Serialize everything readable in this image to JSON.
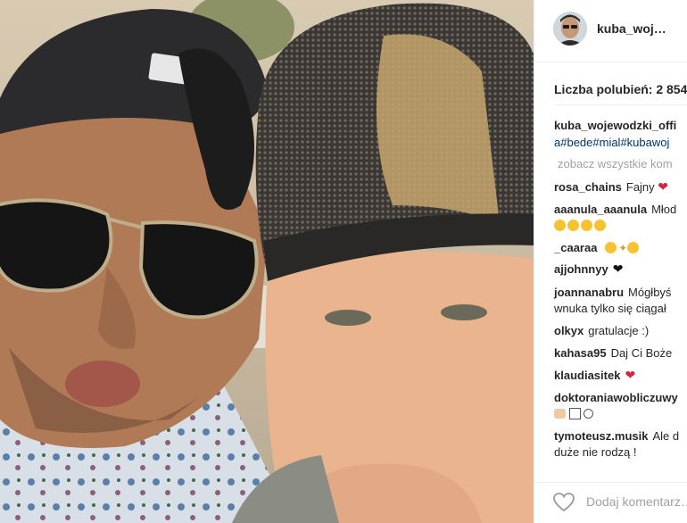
{
  "post": {
    "username": "kuba_woj…",
    "likes_text": "Liczba polubień: 2 854"
  },
  "caption": {
    "username": "kuba_wojewodzki_offi",
    "tags": "a#bede#mial#kubawoj"
  },
  "see_all": "zobacz wszystkie kom",
  "comments": [
    {
      "user": "rosa_chains",
      "text": "Fajny",
      "icon": "broken-heart-icon"
    },
    {
      "user": "aaanula_aaanula",
      "text": "Młod",
      "line2": "",
      "icon": "smiley-icons"
    },
    {
      "user": "_caaraa",
      "text": "",
      "icon": "smiley-sparkle-icons"
    },
    {
      "user": "ajjohnnyy",
      "text": "",
      "icon": "black-heart-icon"
    },
    {
      "user": "joannanabru",
      "text": "Mógłbyś",
      "line2": "wnuka tylko się ciągał"
    },
    {
      "user": "olkyx",
      "text": "gratulacje :)"
    },
    {
      "user": "kahasa95",
      "text": "Daj Ci Boże"
    },
    {
      "user": "klaudiasitek",
      "text": "",
      "icon": "red-heart-icon"
    },
    {
      "user": "doktoraniawobliczuwy",
      "text": "",
      "icon": "hand-icons"
    },
    {
      "user": "tymoteusz.musik",
      "text": "Ale d",
      "line2": "duże nie rodzą !"
    }
  ],
  "footer": {
    "add_comment_placeholder": "Dodaj komentarz…"
  },
  "colors": {
    "username": "#262626",
    "hashtag": "#003569",
    "muted": "#a0a0a0",
    "heart_red": "#d6243a"
  }
}
